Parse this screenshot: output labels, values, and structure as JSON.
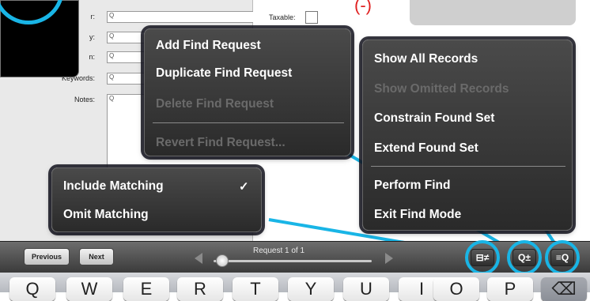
{
  "form": {
    "fields": [
      {
        "label": "r:",
        "value": "Q"
      },
      {
        "label": "y:",
        "value": "Q"
      },
      {
        "label": "n:",
        "value": "Q"
      },
      {
        "label": "Keywords:",
        "value": "Q"
      },
      {
        "label": "Notes:",
        "value": "Q"
      }
    ],
    "taxable_label": "Taxable:"
  },
  "find_menu": {
    "items": [
      {
        "label": "Add Find Request",
        "enabled": true
      },
      {
        "label": "Duplicate Find Request",
        "enabled": true
      },
      {
        "label": "Delete Find Request",
        "enabled": false
      },
      {
        "label": "Revert Find Request...",
        "enabled": false
      }
    ]
  },
  "records_menu": {
    "items": [
      {
        "label": "Show All Records",
        "enabled": true
      },
      {
        "label": "Show Omitted Records",
        "enabled": false
      },
      {
        "label": "Constrain Found Set",
        "enabled": true
      },
      {
        "label": "Extend Found Set",
        "enabled": true
      },
      {
        "label": "Perform Find",
        "enabled": true
      },
      {
        "label": "Exit Find Mode",
        "enabled": true
      }
    ]
  },
  "match_menu": {
    "items": [
      {
        "label": "Include Matching",
        "checked": true
      },
      {
        "label": "Omit Matching",
        "checked": false
      }
    ],
    "check_glyph": "✓"
  },
  "bottom_bar": {
    "previous_label": "Previous",
    "next_label": "Next",
    "request_label": "Request 1 of 1",
    "tools": [
      {
        "icon": "include-omit-icon",
        "glyph": "⊟≠"
      },
      {
        "icon": "find-plus-minus-icon",
        "glyph": "Q±"
      },
      {
        "icon": "find-requests-list-icon",
        "glyph": "≡Q"
      }
    ]
  },
  "keyboard": {
    "keys": [
      "Q",
      "W",
      "E",
      "R",
      "T",
      "Y",
      "U",
      "I",
      "O",
      "P",
      "⌫"
    ]
  },
  "top_fragment": "(-)",
  "colors": {
    "highlight": "#19b5e6",
    "menu_bg": "#3a3a3a",
    "disabled_text": "#6a6a6a"
  }
}
